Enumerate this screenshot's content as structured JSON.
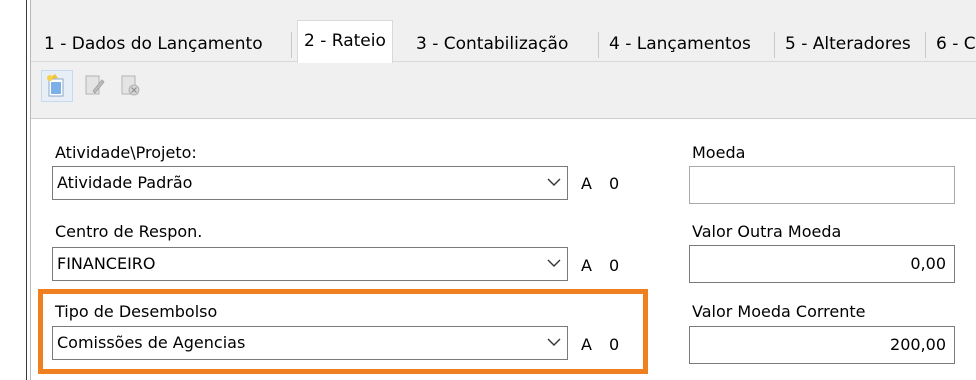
{
  "tabs": [
    {
      "label": "1 - Dados do Lançamento"
    },
    {
      "label": "2 - Rateio",
      "active": true
    },
    {
      "label": "3 - Contabilização"
    },
    {
      "label": "4 - Lançamentos"
    },
    {
      "label": "5 - Alteradores"
    },
    {
      "label": "6 - C"
    }
  ],
  "toolbar": {
    "icons": [
      "new-document-icon",
      "edit-document-icon",
      "delete-document-icon"
    ]
  },
  "form": {
    "atividade": {
      "label": "Atividade\\Projeto:",
      "value": "Atividade Padrão",
      "flag_a": "A",
      "flag_0": "0"
    },
    "centro": {
      "label": "Centro de Respon.",
      "value": "FINANCEIRO",
      "flag_a": "A",
      "flag_0": "0"
    },
    "tipo": {
      "label": "Tipo de Desembolso",
      "value": "Comissões de Agencias",
      "flag_a": "A",
      "flag_0": "0"
    },
    "moeda": {
      "label": "Moeda",
      "value": ""
    },
    "valor_outra": {
      "label": "Valor Outra Moeda",
      "value": "0,00"
    },
    "valor_corrente": {
      "label": "Valor Moeda Corrente",
      "value": "200,00"
    }
  },
  "colors": {
    "highlight": "#f07f1f",
    "tab_bg": "#f0f0f0"
  }
}
